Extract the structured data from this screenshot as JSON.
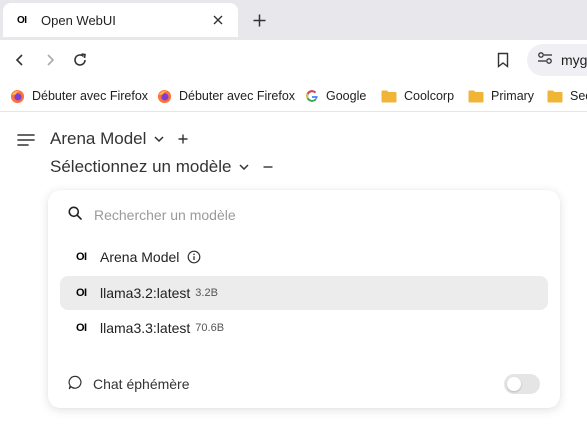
{
  "browser": {
    "tab": {
      "title": "Open WebUI",
      "favicon": "OI"
    },
    "url_text": "myg",
    "bookmarks": [
      {
        "label": "Débuter avec Firefox",
        "icon": "firefox-icon"
      },
      {
        "label": "Débuter avec Firefox",
        "icon": "firefox-icon"
      },
      {
        "label": "Google",
        "icon": "google-icon"
      },
      {
        "label": "Coolcorp",
        "icon": "folder-icon"
      },
      {
        "label": "Primary",
        "icon": "folder-icon"
      },
      {
        "label": "Sec",
        "icon": "folder-icon"
      }
    ]
  },
  "app": {
    "models": [
      {
        "label": "Arena Model"
      },
      {
        "label": "Sélectionnez un modèle"
      }
    ],
    "dropdown": {
      "search_placeholder": "Rechercher un modèle",
      "items": [
        {
          "icon_text": "OI",
          "name": "Arena Model",
          "size": ""
        },
        {
          "icon_text": "OI",
          "name": "llama3.2:latest",
          "size": "3.2B",
          "selected": true
        },
        {
          "icon_text": "OI",
          "name": "llama3.3:latest",
          "size": "70.6B"
        }
      ],
      "ephemeral_label": "Chat éphémère"
    }
  },
  "colors": {
    "tabstrip": "#e8e8ec",
    "selected_item": "#ececec",
    "folder": "#f0b537"
  }
}
